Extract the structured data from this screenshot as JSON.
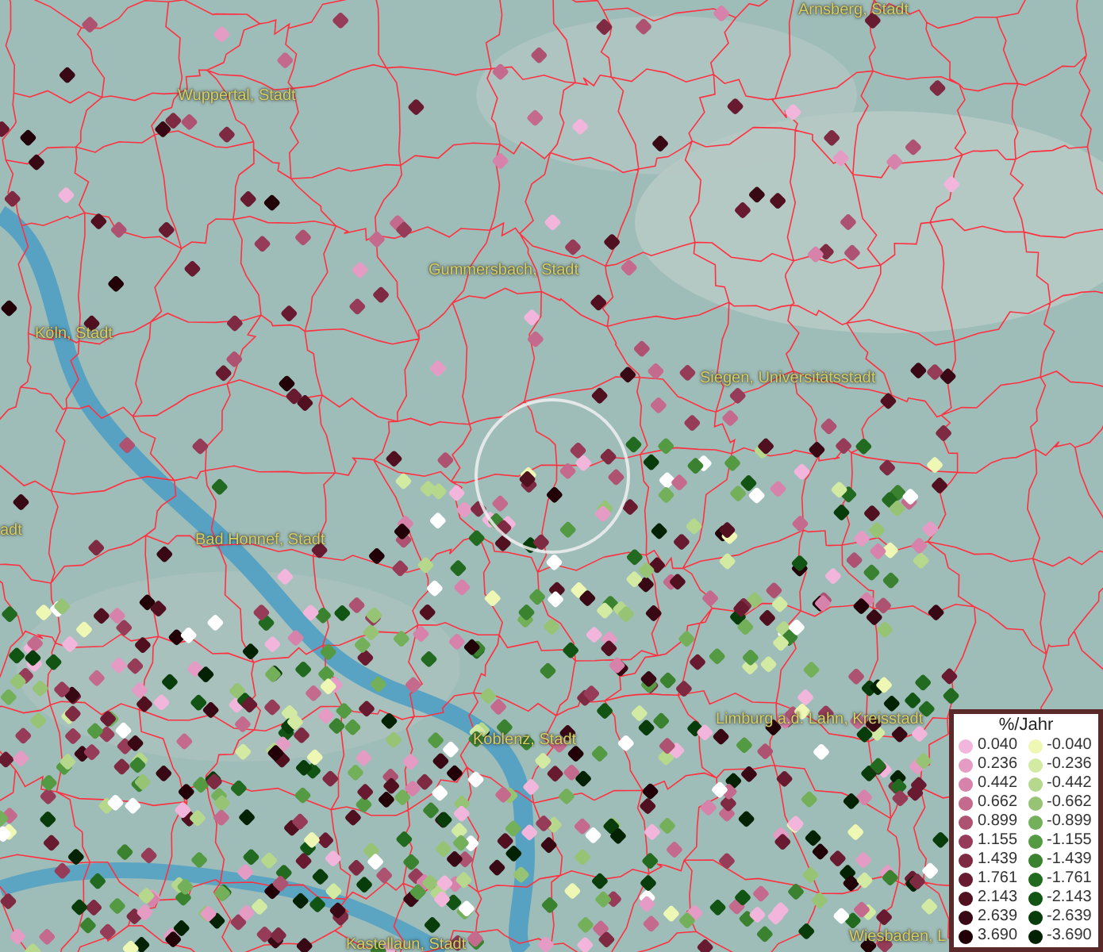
{
  "map": {
    "places": [
      {
        "name": "Arnsberg, Stadt"
      },
      {
        "name": "Wuppertal, Stadt"
      },
      {
        "name": "Gummersbach, Stadt"
      },
      {
        "name": "Köln, Stadt"
      },
      {
        "name": "Siegen, Universitätsstadt"
      },
      {
        "name": "adt"
      },
      {
        "name": "Bad Honnef, Stadt"
      },
      {
        "name": "Limburg a.d. Lahn, Kreisstadt"
      },
      {
        "name": "Koblenz, Stadt"
      },
      {
        "name": "Wiesbaden, L"
      },
      {
        "name": "Kastellaun, Stadt"
      }
    ]
  },
  "legend": {
    "title": "%/Jahr",
    "entries": [
      {
        "label": "0.040",
        "color": "#f2b6dc"
      },
      {
        "label": "-0.040",
        "color": "#eef7b4"
      },
      {
        "label": "0.236",
        "color": "#e49cc4"
      },
      {
        "label": "-0.236",
        "color": "#d3eaa2"
      },
      {
        "label": "0.442",
        "color": "#d682aa"
      },
      {
        "label": "-0.442",
        "color": "#b6d88c"
      },
      {
        "label": "0.662",
        "color": "#c46a8c"
      },
      {
        "label": "-0.662",
        "color": "#96c474"
      },
      {
        "label": "0.899",
        "color": "#ae5272"
      },
      {
        "label": "-0.899",
        "color": "#74b05a"
      },
      {
        "label": "1.155",
        "color": "#963c58"
      },
      {
        "label": "-1.155",
        "color": "#549a42"
      },
      {
        "label": "1.439",
        "color": "#7e2a42"
      },
      {
        "label": "-1.439",
        "color": "#3a8230"
      },
      {
        "label": "1.761",
        "color": "#681a30"
      },
      {
        "label": "-1.761",
        "color": "#226a20"
      },
      {
        "label": "2.143",
        "color": "#501020"
      },
      {
        "label": "-2.143",
        "color": "#125414"
      },
      {
        "label": "2.639",
        "color": "#380814"
      },
      {
        "label": "-2.639",
        "color": "#083c0a"
      },
      {
        "label": "3.690",
        "color": "#220008"
      },
      {
        "label": "-3.690",
        "color": "#032204"
      }
    ]
  }
}
